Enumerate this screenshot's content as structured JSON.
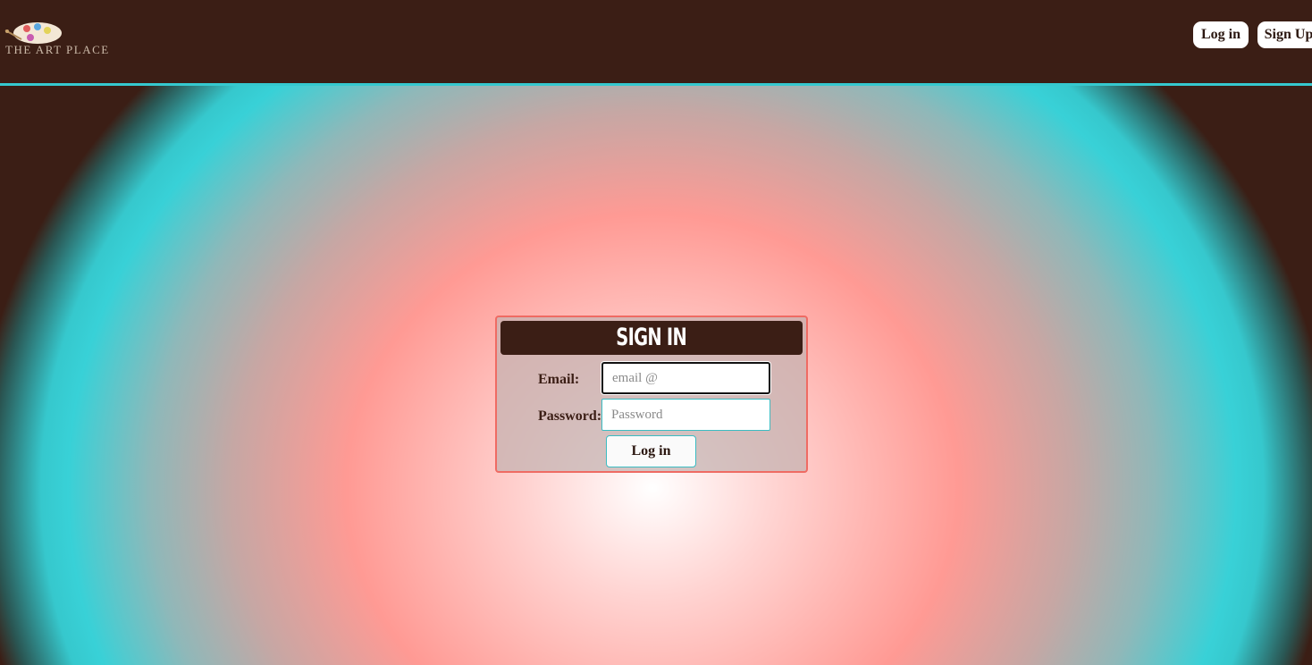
{
  "header": {
    "logo_text": "THE ART PLACE",
    "login_label": "Log in",
    "signup_label": "Sign Up"
  },
  "signin": {
    "title": "SIGN IN",
    "email_label": "Email:",
    "email_placeholder": "email @",
    "password_label": "Password:",
    "password_placeholder": "Password",
    "submit_label": "Log in"
  },
  "colors": {
    "brand_brown": "#3b1e15",
    "accent_teal": "#35c9cf",
    "accent_coral": "#ef6b63"
  }
}
